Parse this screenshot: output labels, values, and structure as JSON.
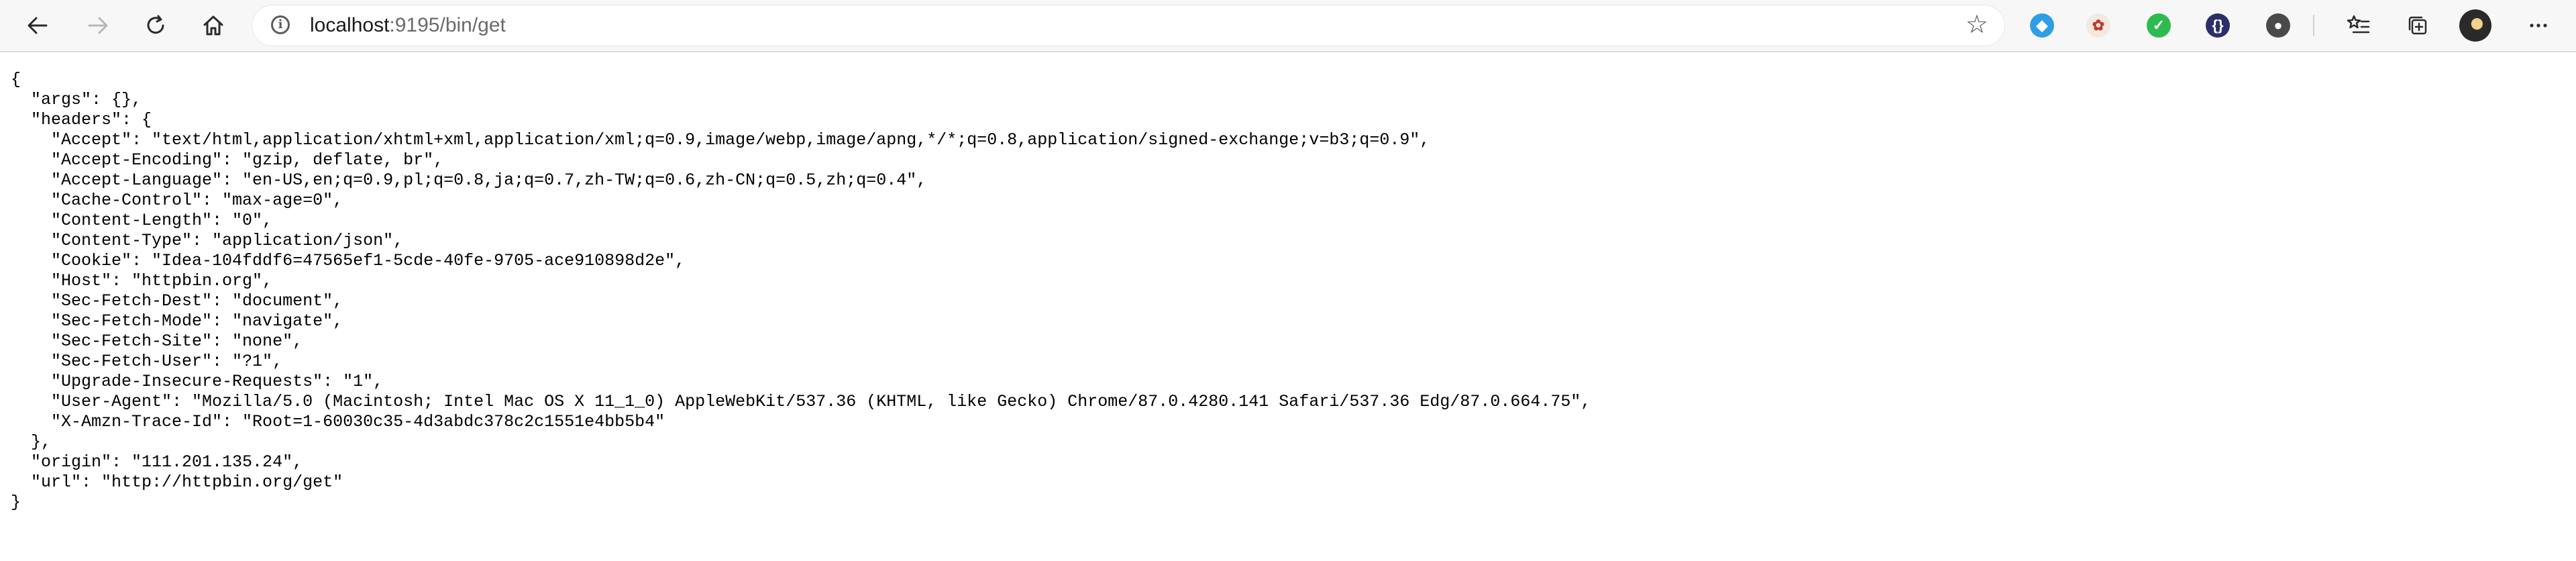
{
  "browser": {
    "address": {
      "host": "localhost",
      "rest": ":9195/bin/get"
    },
    "icons": {
      "back": "back-arrow-icon",
      "forward": "forward-arrow-icon",
      "refresh": "refresh-icon",
      "home": "home-icon",
      "site_info": "site-info-icon",
      "favorite": "star-icon",
      "collections": "collections-icon",
      "favorites_list": "favorites-list-icon",
      "more": "more-icon"
    },
    "extensions": [
      {
        "name": "feedly-ext-icon",
        "color": "#2f9ee6",
        "glyph": "◆"
      },
      {
        "name": "sticker-ext-icon",
        "color": "#f3e9e0",
        "glyph": "✿"
      },
      {
        "name": "checkmark-ext-icon",
        "color": "#2dbb4e",
        "glyph": "✓"
      },
      {
        "name": "bracket-ext-icon",
        "color": "#2b2f6b",
        "glyph": "{}"
      },
      {
        "name": "evernote-ext-icon",
        "color": "#4a4a4a",
        "glyph": "●"
      }
    ]
  },
  "response_lines": [
    "{",
    "  \"args\": {},",
    "  \"headers\": {",
    "    \"Accept\": \"text/html,application/xhtml+xml,application/xml;q=0.9,image/webp,image/apng,*/*;q=0.8,application/signed-exchange;v=b3;q=0.9\",",
    "    \"Accept-Encoding\": \"gzip, deflate, br\",",
    "    \"Accept-Language\": \"en-US,en;q=0.9,pl;q=0.8,ja;q=0.7,zh-TW;q=0.6,zh-CN;q=0.5,zh;q=0.4\",",
    "    \"Cache-Control\": \"max-age=0\",",
    "    \"Content-Length\": \"0\",",
    "    \"Content-Type\": \"application/json\",",
    "    \"Cookie\": \"Idea-104fddf6=47565ef1-5cde-40fe-9705-ace910898d2e\",",
    "    \"Host\": \"httpbin.org\",",
    "    \"Sec-Fetch-Dest\": \"document\",",
    "    \"Sec-Fetch-Mode\": \"navigate\",",
    "    \"Sec-Fetch-Site\": \"none\",",
    "    \"Sec-Fetch-User\": \"?1\",",
    "    \"Upgrade-Insecure-Requests\": \"1\",",
    "    \"User-Agent\": \"Mozilla/5.0 (Macintosh; Intel Mac OS X 11_1_0) AppleWebKit/537.36 (KHTML, like Gecko) Chrome/87.0.4280.141 Safari/537.36 Edg/87.0.664.75\",",
    "    \"X-Amzn-Trace-Id\": \"Root=1-60030c35-4d3abdc378c2c1551e4bb5b4\"",
    "  },",
    "  \"origin\": \"111.201.135.24\",",
    "  \"url\": \"http://httpbin.org/get\"",
    "}"
  ]
}
